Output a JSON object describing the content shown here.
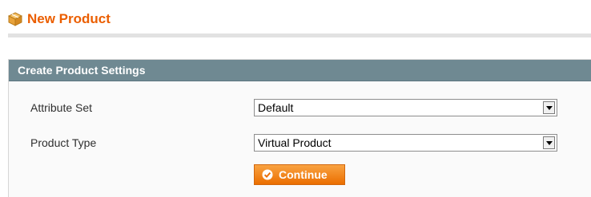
{
  "page": {
    "title": "New Product",
    "title_icon": "box-icon"
  },
  "settings": {
    "heading": "Create Product Settings",
    "fields": [
      {
        "label": "Attribute Set",
        "value": "Default"
      },
      {
        "label": "Product Type",
        "value": "Virtual Product"
      }
    ],
    "continue_label": "Continue"
  },
  "colors": {
    "title": "#eb5e00",
    "section_header": "#6f8992",
    "button": "#f18200"
  }
}
